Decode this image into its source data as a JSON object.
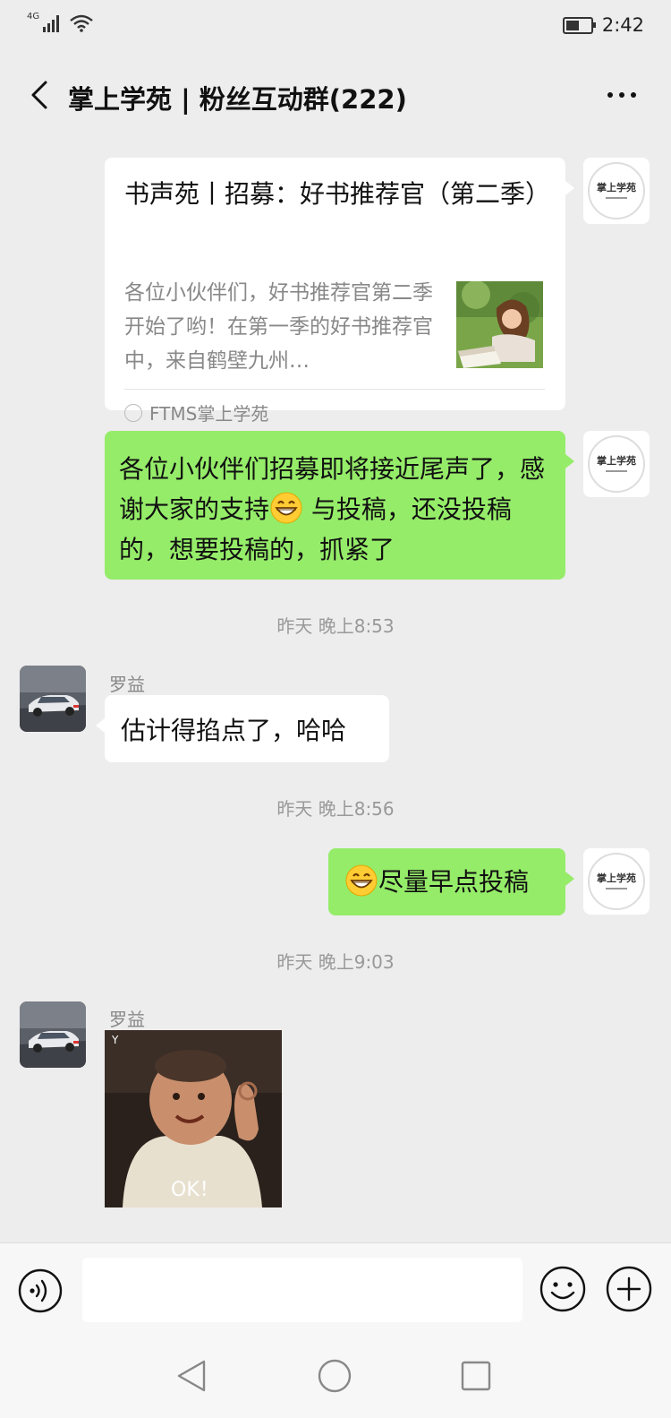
{
  "status_bar": {
    "network": "4G",
    "time": "2:42"
  },
  "header": {
    "title": "掌上学苑 | 粉丝互动群(222)"
  },
  "self_avatar": {
    "logo_text": "掌上学苑"
  },
  "messages": {
    "card": {
      "title": "书声苑丨招募：好书推荐官（第二季）",
      "description": "各位小伙伴们，好书推荐官第二季开始了哟！在第一季的好书推荐官中，来自鹤壁九州…",
      "source": "FTMS掌上学苑"
    },
    "msg1": {
      "before": "各位小伙伴们招募即将接近尾声了，感谢大家的支持",
      "after": " 与投稿，还没投稿的，想要投稿的，抓紧了"
    },
    "ts1": "昨天 晚上8:53",
    "sender1": "罗益",
    "msg2": "估计得掐点了，哈哈",
    "ts2": "昨天 晚上8:56",
    "msg3": "尽量早点投稿",
    "ts3": "昨天 晚上9:03",
    "sender2": "罗益",
    "sticker": {
      "corner": "Y",
      "caption": "OK！"
    }
  },
  "input": {
    "value": "",
    "placeholder": ""
  },
  "icons": {
    "back": "chevron-left-icon",
    "more": "more-icon",
    "voice": "voice-icon",
    "emoji": "emoji-icon",
    "plus": "plus-icon",
    "battery": "battery-icon",
    "wifi": "wifi-icon",
    "signal": "signal-icon"
  },
  "colors": {
    "background": "#ededed",
    "self_bubble": "#95ec69",
    "other_bubble": "#ffffff",
    "secondary_text": "#888888"
  }
}
